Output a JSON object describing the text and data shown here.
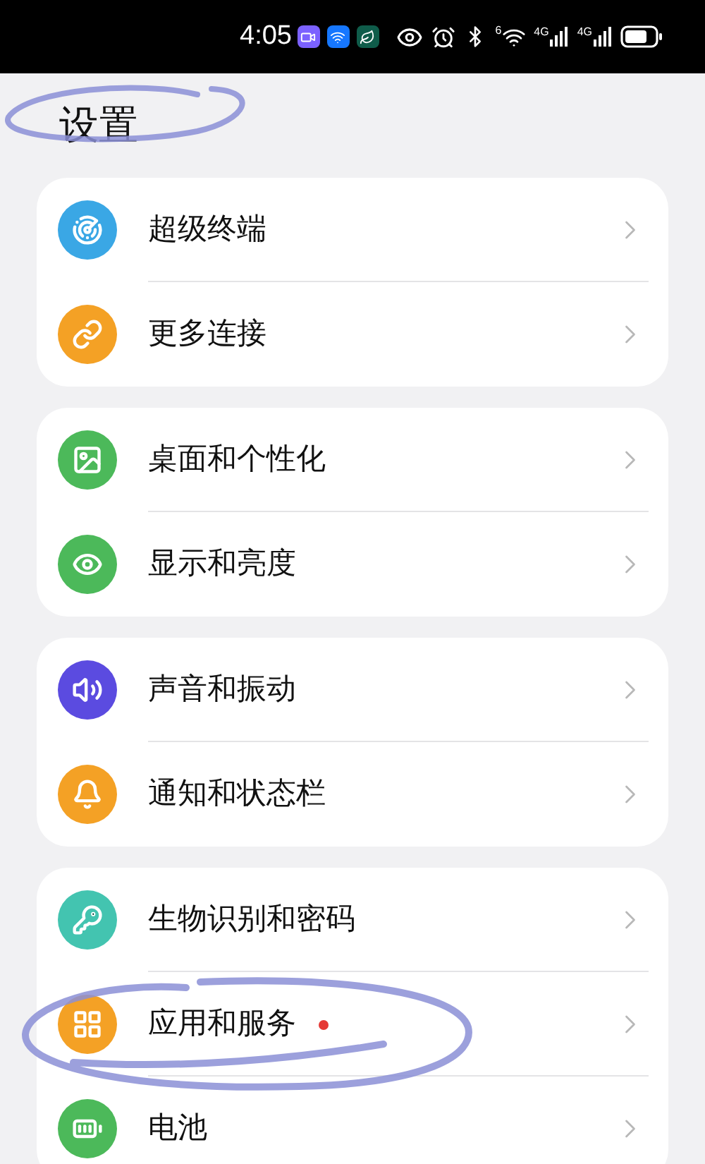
{
  "status_bar": {
    "time": "4:05",
    "apps": [
      {
        "kind": "video",
        "color": "#7b61ff"
      },
      {
        "kind": "alipay",
        "color": "#1677ff"
      },
      {
        "kind": "leaf",
        "color": "#0f5c4a"
      }
    ],
    "wifi_label": "6",
    "signals": [
      "4G",
      "4G"
    ]
  },
  "title": "设置",
  "groups": [
    {
      "items": [
        {
          "label": "超级终端",
          "kind": "radar",
          "color": "#3aa7e5",
          "badge": false
        },
        {
          "label": "更多连接",
          "kind": "link",
          "color": "#f4a125",
          "badge": false
        }
      ]
    },
    {
      "items": [
        {
          "label": "桌面和个性化",
          "kind": "image",
          "color": "#4cb95a",
          "badge": false
        },
        {
          "label": "显示和亮度",
          "kind": "eye",
          "color": "#4cb95a",
          "badge": false
        }
      ]
    },
    {
      "items": [
        {
          "label": "声音和振动",
          "kind": "sound",
          "color": "#5b4be0",
          "badge": false
        },
        {
          "label": "通知和状态栏",
          "kind": "bell",
          "color": "#f4a125",
          "badge": false
        }
      ]
    },
    {
      "items": [
        {
          "label": "生物识别和密码",
          "kind": "key",
          "color": "#43c4b0",
          "badge": false
        },
        {
          "label": "应用和服务",
          "kind": "grid",
          "color": "#f4a125",
          "badge": true
        },
        {
          "label": "电池",
          "kind": "battery",
          "color": "#4cb95a",
          "badge": false
        }
      ]
    }
  ]
}
